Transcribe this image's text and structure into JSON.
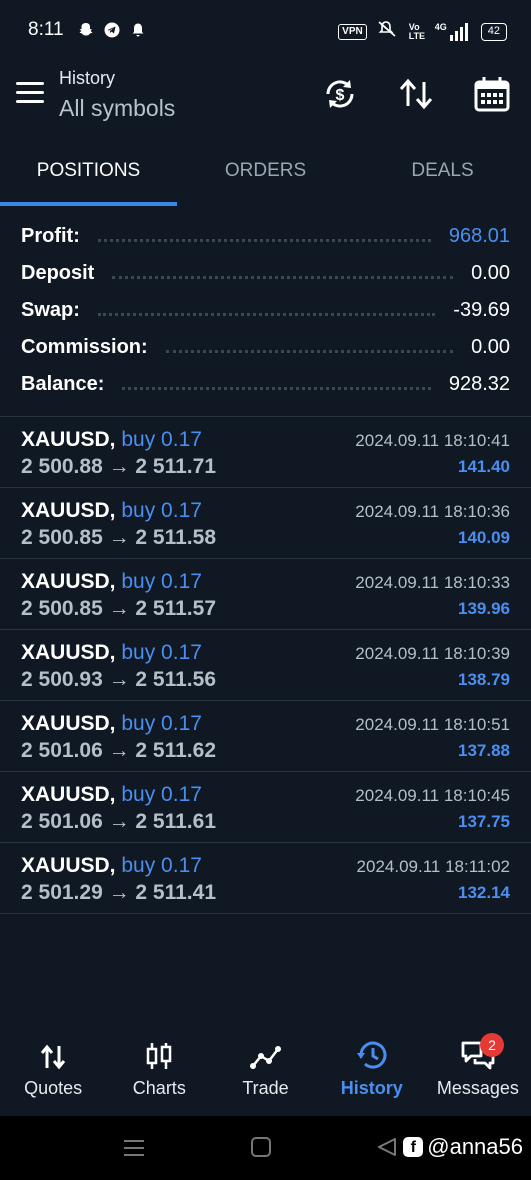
{
  "status_bar": {
    "time": "8:11",
    "vpn": "VPN",
    "network_volte": "Vo LTE",
    "network_type": "4G",
    "battery": "42"
  },
  "header": {
    "title": "History",
    "subtitle": "All symbols"
  },
  "tabs": [
    {
      "label": "POSITIONS",
      "active": true
    },
    {
      "label": "ORDERS",
      "active": false
    },
    {
      "label": "DEALS",
      "active": false
    }
  ],
  "summary": [
    {
      "label": "Profit:",
      "value": "968.01",
      "highlight": true
    },
    {
      "label": "Deposit",
      "value": "0.00",
      "highlight": false
    },
    {
      "label": "Swap:",
      "value": "-39.69",
      "highlight": false
    },
    {
      "label": "Commission:",
      "value": "0.00",
      "highlight": false
    },
    {
      "label": "Balance:",
      "value": "928.32",
      "highlight": false
    }
  ],
  "positions": [
    {
      "symbol": "XAUUSD,",
      "side": "buy 0.17",
      "prices": "2 500.88 → 2 511.71",
      "time": "2024.09.11 18:10:41",
      "profit": "141.40"
    },
    {
      "symbol": "XAUUSD,",
      "side": "buy 0.17",
      "prices": "2 500.85 → 2 511.58",
      "time": "2024.09.11 18:10:36",
      "profit": "140.09"
    },
    {
      "symbol": "XAUUSD,",
      "side": "buy 0.17",
      "prices": "2 500.85 → 2 511.57",
      "time": "2024.09.11 18:10:33",
      "profit": "139.96"
    },
    {
      "symbol": "XAUUSD,",
      "side": "buy 0.17",
      "prices": "2 500.93 → 2 511.56",
      "time": "2024.09.11 18:10:39",
      "profit": "138.79"
    },
    {
      "symbol": "XAUUSD,",
      "side": "buy 0.17",
      "prices": "2 501.06 → 2 511.62",
      "time": "2024.09.11 18:10:51",
      "profit": "137.88"
    },
    {
      "symbol": "XAUUSD,",
      "side": "buy 0.17",
      "prices": "2 501.06 → 2 511.61",
      "time": "2024.09.11 18:10:45",
      "profit": "137.75"
    },
    {
      "symbol": "XAUUSD,",
      "side": "buy 0.17",
      "prices": "2 501.29 → 2 511.41",
      "time": "2024.09.11 18:11:02",
      "profit": "132.14"
    }
  ],
  "bottom_nav": [
    {
      "label": "Quotes",
      "icon": "quotes-icon",
      "active": false
    },
    {
      "label": "Charts",
      "icon": "charts-icon",
      "active": false
    },
    {
      "label": "Trade",
      "icon": "trade-icon",
      "active": false
    },
    {
      "label": "History",
      "icon": "history-icon",
      "active": true
    },
    {
      "label": "Messages",
      "icon": "messages-icon",
      "active": false
    }
  ],
  "messages_badge": "2",
  "watermark": "@anna56",
  "colors": {
    "background": "#0f1823",
    "accent": "#4a8ff0",
    "tab_indicator": "#3e86ea",
    "badge": "#e53935"
  }
}
